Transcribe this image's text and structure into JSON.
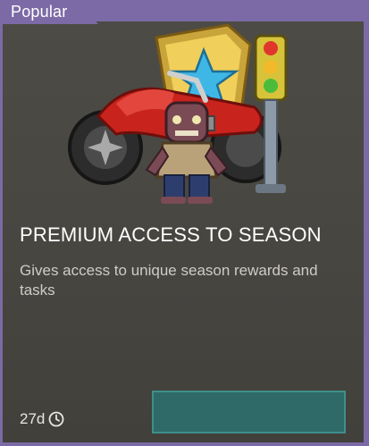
{
  "offer": {
    "tag_label": "Popular",
    "title": "PREMIUM ACCESS TO SEASON",
    "description": "Gives access to unique season rewards and tasks",
    "time_left": "27d"
  },
  "icons": {
    "timer": "clock-icon",
    "art": [
      "motorcycle-icon",
      "star-shield-icon",
      "traffic-light-icon",
      "zombie-icon"
    ]
  },
  "colors": {
    "accent": "#7b6aa6",
    "panel": "#4a4843",
    "button": "#2f6a68",
    "button_border": "#3e8f8b"
  }
}
